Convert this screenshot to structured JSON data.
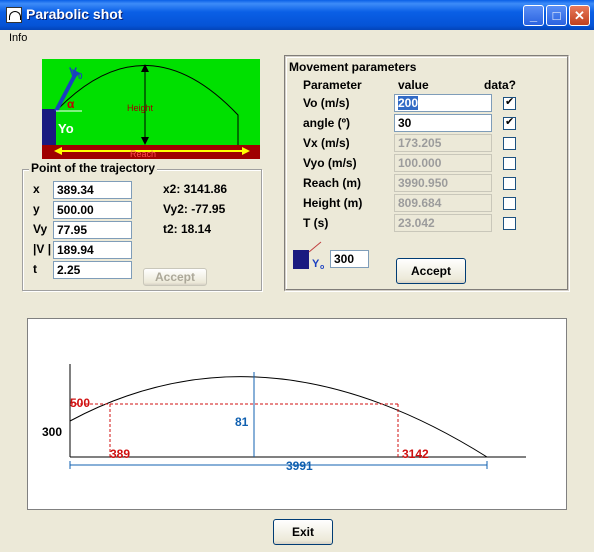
{
  "window": {
    "title": "Parabolic shot"
  },
  "menu": {
    "info": "Info"
  },
  "diagram": {
    "v0": "V",
    "v0_sub": "0",
    "alpha": "α",
    "yo": "Yo",
    "height": "Height",
    "reach": "Reach",
    "colors": {
      "field": "#00e000",
      "ground": "#a00000",
      "cannon": "#1a1a80",
      "arrow": "#1a3fc0"
    }
  },
  "point": {
    "title": "Point of the trajectory",
    "x_label": "x",
    "x": "389.34",
    "y_label": "y",
    "y": "500.00",
    "vy_label": "Vy",
    "vy": "77.95",
    "v_label": "|V |",
    "v": "189.94",
    "t_label": "t",
    "t": "2.25",
    "x2": "x2: 3141.86",
    "vy2": "Vy2: -77.95",
    "t2": "t2:  18.14",
    "accept": "Accept"
  },
  "movement": {
    "title": "Movement parameters",
    "headers": [
      "Parameter",
      "value",
      "data?"
    ],
    "rows": [
      {
        "label": "Vo (m/s)",
        "value": "200",
        "checked": true,
        "enabled": true
      },
      {
        "label": "angle (º)",
        "value": "30",
        "checked": true,
        "enabled": true
      },
      {
        "label": "Vx (m/s)",
        "value": "173.205",
        "checked": false,
        "enabled": false
      },
      {
        "label": "Vyo (m/s)",
        "value": "100.000",
        "checked": false,
        "enabled": false
      },
      {
        "label": "Reach (m)",
        "value": "3990.950",
        "checked": false,
        "enabled": false
      },
      {
        "label": "Height (m)",
        "value": "809.684",
        "checked": false,
        "enabled": false
      },
      {
        "label": "T (s)",
        "value": "23.042",
        "checked": false,
        "enabled": false
      }
    ],
    "y0_label": "Y",
    "y0_sub": "o",
    "y0_value": "300",
    "accept": "Accept"
  },
  "plot": {
    "y_point": "500",
    "y0": "300",
    "height": "81",
    "x1": "389",
    "x2": "3142",
    "reach": "3991",
    "colors": {
      "marker": "#d01010",
      "measure": "#1060b0"
    }
  },
  "exit": "Exit"
}
